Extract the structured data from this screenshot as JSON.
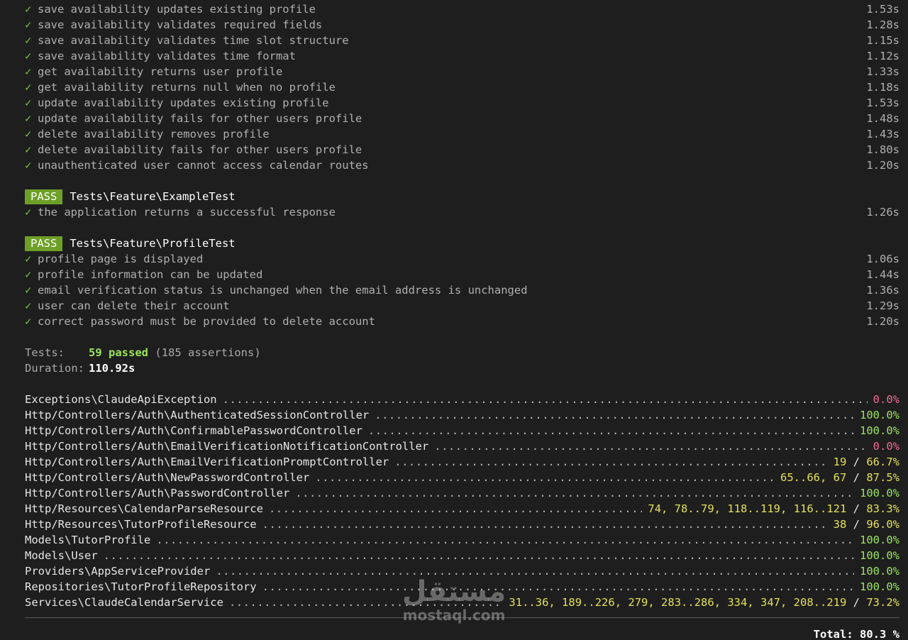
{
  "calendar_tests": [
    {
      "name": "save availability updates existing profile",
      "time": "1.53s"
    },
    {
      "name": "save availability validates required fields",
      "time": "1.28s"
    },
    {
      "name": "save availability validates time slot structure",
      "time": "1.15s"
    },
    {
      "name": "save availability validates time format",
      "time": "1.12s"
    },
    {
      "name": "get availability returns user profile",
      "time": "1.33s"
    },
    {
      "name": "get availability returns null when no profile",
      "time": "1.18s"
    },
    {
      "name": "update availability updates existing profile",
      "time": "1.53s"
    },
    {
      "name": "update availability fails for other users profile",
      "time": "1.48s"
    },
    {
      "name": "delete availability removes profile",
      "time": "1.43s"
    },
    {
      "name": "delete availability fails for other users profile",
      "time": "1.80s"
    },
    {
      "name": "unauthenticated user cannot access calendar routes",
      "time": "1.20s"
    }
  ],
  "check_glyph": "✓",
  "suites": [
    {
      "badge": "PASS",
      "name": "Tests\\Feature\\ExampleTest",
      "tests": [
        {
          "name": "the application returns a successful response",
          "time": "1.26s"
        }
      ]
    },
    {
      "badge": "PASS",
      "name": "Tests\\Feature\\ProfileTest",
      "tests": [
        {
          "name": "profile page is displayed",
          "time": "1.06s"
        },
        {
          "name": "profile information can be updated",
          "time": "1.44s"
        },
        {
          "name": "email verification status is unchanged when the email address is unchanged",
          "time": "1.36s"
        },
        {
          "name": "user can delete their account",
          "time": "1.29s"
        },
        {
          "name": "correct password must be provided to delete account",
          "time": "1.20s"
        }
      ]
    }
  ],
  "summary": {
    "tests_label": "Tests:",
    "passed": "59 passed",
    "assertions": "(185 assertions)",
    "duration_label": "Duration:",
    "duration": "110.92s"
  },
  "coverage": [
    {
      "file": "Exceptions\\ClaudeApiException",
      "uncovered": "",
      "percent": "0.0%",
      "status": "zero"
    },
    {
      "file": "Http/Controllers/Auth\\AuthenticatedSessionController",
      "uncovered": "",
      "percent": "100.0%",
      "status": "full"
    },
    {
      "file": "Http/Controllers/Auth\\ConfirmablePasswordController",
      "uncovered": "",
      "percent": "100.0%",
      "status": "full"
    },
    {
      "file": "Http/Controllers/Auth\\EmailVerificationNotificationController",
      "uncovered": "",
      "percent": "0.0%",
      "status": "zero"
    },
    {
      "file": "Http/Controllers/Auth\\EmailVerificationPromptController",
      "uncovered": "19",
      "percent": "66.7%",
      "status": "part"
    },
    {
      "file": "Http/Controllers/Auth\\NewPasswordController",
      "uncovered": "65..66, 67",
      "percent": "87.5%",
      "status": "part"
    },
    {
      "file": "Http/Controllers/Auth\\PasswordController",
      "uncovered": "",
      "percent": "100.0%",
      "status": "full"
    },
    {
      "file": "Http/Resources\\CalendarParseResource",
      "uncovered": "74, 78..79, 118..119, 116..121",
      "percent": "83.3%",
      "status": "part"
    },
    {
      "file": "Http/Resources\\TutorProfileResource",
      "uncovered": "38",
      "percent": "96.0%",
      "status": "part"
    },
    {
      "file": "Models\\TutorProfile",
      "uncovered": "",
      "percent": "100.0%",
      "status": "full"
    },
    {
      "file": "Models\\User",
      "uncovered": "",
      "percent": "100.0%",
      "status": "full"
    },
    {
      "file": "Providers\\AppServiceProvider",
      "uncovered": "",
      "percent": "100.0%",
      "status": "full"
    },
    {
      "file": "Repositories\\TutorProfileRepository",
      "uncovered": "",
      "percent": "100.0%",
      "status": "full"
    },
    {
      "file": "Services\\ClaudeCalendarService",
      "uncovered": "31..36, 189..226, 279, 283..286, 334, 347, 208..219",
      "percent": "73.2%",
      "status": "part"
    }
  ],
  "total": "Total: 80.3 %",
  "watermark": {
    "arabic": "مستقل",
    "latin": "mostaql.com"
  },
  "colors": {
    "background": "#1e1e1e",
    "pass_badge": "#6ea028",
    "check": "#6cc644",
    "full": "#9be55c",
    "partial": "#e5e059",
    "zero": "#f06a8e"
  }
}
